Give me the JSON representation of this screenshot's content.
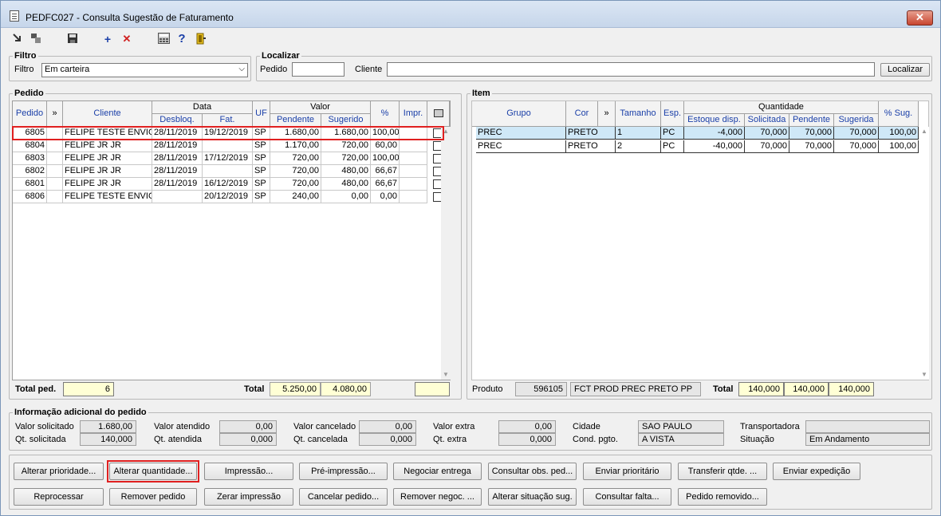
{
  "window": {
    "title": "PEDFC027 - Consulta Sugestão de Faturamento",
    "close": "✕"
  },
  "toolbar": {
    "add": "+",
    "delete": "✕",
    "help": "?"
  },
  "filtro": {
    "legend": "Filtro",
    "label": "Filtro",
    "value": "Em carteira"
  },
  "localizar": {
    "legend": "Localizar",
    "pedido_label": "Pedido",
    "pedido_value": "",
    "cliente_label": "Cliente",
    "cliente_value": "",
    "button": "Localizar"
  },
  "pedido": {
    "legend": "Pedido",
    "headers": {
      "pedido": "Pedido",
      "more": "»",
      "cliente": "Cliente",
      "data": "Data",
      "desbloq": "Desbloq.",
      "fat": "Fat.",
      "uf": "UF",
      "valor": "Valor",
      "pendente": "Pendente",
      "sugerido": "Sugerido",
      "pct": "%",
      "impr": "Impr."
    },
    "rows": [
      {
        "pedido": "6805",
        "cliente": "FELIPE TESTE ENVIO C",
        "desbloq": "28/11/2019",
        "fat": "19/12/2019",
        "uf": "SP",
        "pendente": "1.680,00",
        "sugerido": "1.680,00",
        "pct": "100,00"
      },
      {
        "pedido": "6804",
        "cliente": "FELIPE JR JR",
        "desbloq": "28/11/2019",
        "fat": "",
        "uf": "SP",
        "pendente": "1.170,00",
        "sugerido": "720,00",
        "pct": "60,00"
      },
      {
        "pedido": "6803",
        "cliente": "FELIPE JR JR",
        "desbloq": "28/11/2019",
        "fat": "17/12/2019",
        "uf": "SP",
        "pendente": "720,00",
        "sugerido": "720,00",
        "pct": "100,00"
      },
      {
        "pedido": "6802",
        "cliente": "FELIPE JR JR",
        "desbloq": "28/11/2019",
        "fat": "",
        "uf": "SP",
        "pendente": "720,00",
        "sugerido": "480,00",
        "pct": "66,67"
      },
      {
        "pedido": "6801",
        "cliente": "FELIPE JR JR",
        "desbloq": "28/11/2019",
        "fat": "16/12/2019",
        "uf": "SP",
        "pendente": "720,00",
        "sugerido": "480,00",
        "pct": "66,67"
      },
      {
        "pedido": "6806",
        "cliente": "FELIPE TESTE ENVIO C",
        "desbloq": "",
        "fat": "20/12/2019",
        "uf": "SP",
        "pendente": "240,00",
        "sugerido": "0,00",
        "pct": "0,00"
      }
    ],
    "total_ped_label": "Total ped.",
    "total_ped_value": "6",
    "total_label": "Total",
    "total_pendente": "5.250,00",
    "total_sugerido": "4.080,00"
  },
  "item": {
    "legend": "Item",
    "headers": {
      "grupo": "Grupo",
      "cor": "Cor",
      "more": "»",
      "tamanho": "Tamanho",
      "esp": "Esp.",
      "quantidade": "Quantidade",
      "estoque": "Estoque disp.",
      "solicitada": "Solicitada",
      "pendente": "Pendente",
      "sugerida": "Sugerida",
      "pct_sug": "% Sug."
    },
    "rows": [
      {
        "grupo": "PREC",
        "cor": "PRETO",
        "tamanho": "1",
        "esp": "PC",
        "estoque": "-4,000",
        "solicitada": "70,000",
        "pendente": "70,000",
        "sugerida": "70,000",
        "pct_sug": "100,00"
      },
      {
        "grupo": "PREC",
        "cor": "PRETO",
        "tamanho": "2",
        "esp": "PC",
        "estoque": "-40,000",
        "solicitada": "70,000",
        "pendente": "70,000",
        "sugerida": "70,000",
        "pct_sug": "100,00"
      }
    ],
    "produto_label": "Produto",
    "produto_code": "596105",
    "produto_desc": "FCT PROD PREC PRETO PP",
    "total_label": "Total",
    "total_solicitada": "140,000",
    "total_pendente": "140,000",
    "total_sugerida": "140,000"
  },
  "info": {
    "legend": "Informação adicional do pedido",
    "valor_solicitado_label": "Valor solicitado",
    "valor_solicitado": "1.680,00",
    "qt_solicitada_label": "Qt. solicitada",
    "qt_solicitada": "140,000",
    "valor_atendido_label": "Valor atendido",
    "valor_atendido": "0,00",
    "qt_atendida_label": "Qt. atendida",
    "qt_atendida": "0,000",
    "valor_cancelado_label": "Valor cancelado",
    "valor_cancelado": "0,00",
    "qt_cancelada_label": "Qt. cancelada",
    "qt_cancelada": "0,000",
    "valor_extra_label": "Valor extra",
    "valor_extra": "0,00",
    "qt_extra_label": "Qt. extra",
    "qt_extra": "0,000",
    "cidade_label": "Cidade",
    "cidade": "SAO PAULO",
    "cond_pgto_label": "Cond. pgto.",
    "cond_pgto": "A VISTA",
    "transportadora_label": "Transportadora",
    "transportadora": "",
    "situacao_label": "Situação",
    "situacao": "Em Andamento"
  },
  "buttons": {
    "alterar_prioridade": "Alterar prioridade...",
    "alterar_quantidade": "Alterar quantidade...",
    "impressao": "Impressão...",
    "pre_impressao": "Pré-impressão...",
    "negociar_entrega": "Negociar entrega",
    "consultar_obs": "Consultar obs. ped...",
    "enviar_prioritario": "Enviar prioritário",
    "transferir_qtde": "Transferir qtde. ...",
    "enviar_expedicao": "Enviar expedição",
    "reprocessar": "Reprocessar",
    "remover_pedido": "Remover pedido",
    "zerar_impressao": "Zerar impressão",
    "cancelar_pedido": "Cancelar pedido...",
    "remover_negoc": "Remover negoc. ...",
    "alterar_situacao": "Alterar situação sug.",
    "consultar_falta": "Consultar falta...",
    "pedido_removido": "Pedido removido..."
  },
  "colors": {
    "highlight_red": "#e02020",
    "selected_row": "#cfe8f7"
  }
}
